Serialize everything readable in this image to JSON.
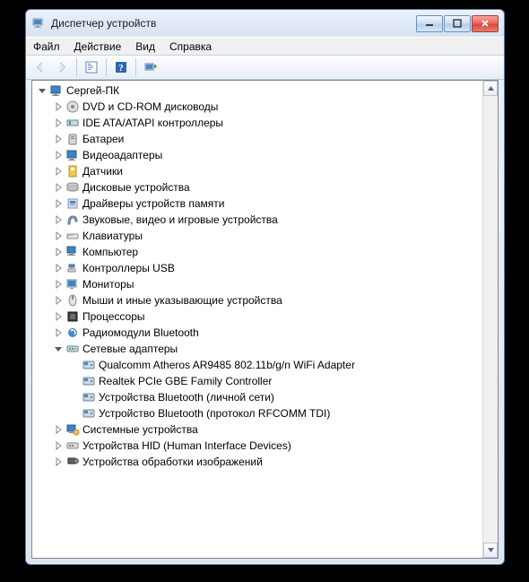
{
  "window": {
    "title": "Диспетчер устройств"
  },
  "menu": {
    "file": "Файл",
    "action": "Действие",
    "view": "Вид",
    "help": "Справка"
  },
  "tree": {
    "root": "Сергей-ПК",
    "categories": [
      "DVD и CD-ROM дисководы",
      "IDE ATA/ATAPI контроллеры",
      "Батареи",
      "Видеоадаптеры",
      "Датчики",
      "Дисковые устройства",
      "Драйверы устройств памяти",
      "Звуковые, видео и игровые устройства",
      "Клавиатуры",
      "Компьютер",
      "Контроллеры USB",
      "Мониторы",
      "Мыши и иные указывающие устройства",
      "Процессоры",
      "Радиомодули Bluetooth",
      "Сетевые адаптеры",
      "Системные устройства",
      "Устройства HID (Human Interface Devices)",
      "Устройства обработки изображений"
    ],
    "network_devices": [
      "Qualcomm Atheros AR9485 802.11b/g/n WiFi Adapter",
      "Realtek PCIe GBE Family Controller",
      "Устройства Bluetooth (личной сети)",
      "Устройство Bluetooth (протокол RFCOMM TDI)"
    ]
  }
}
